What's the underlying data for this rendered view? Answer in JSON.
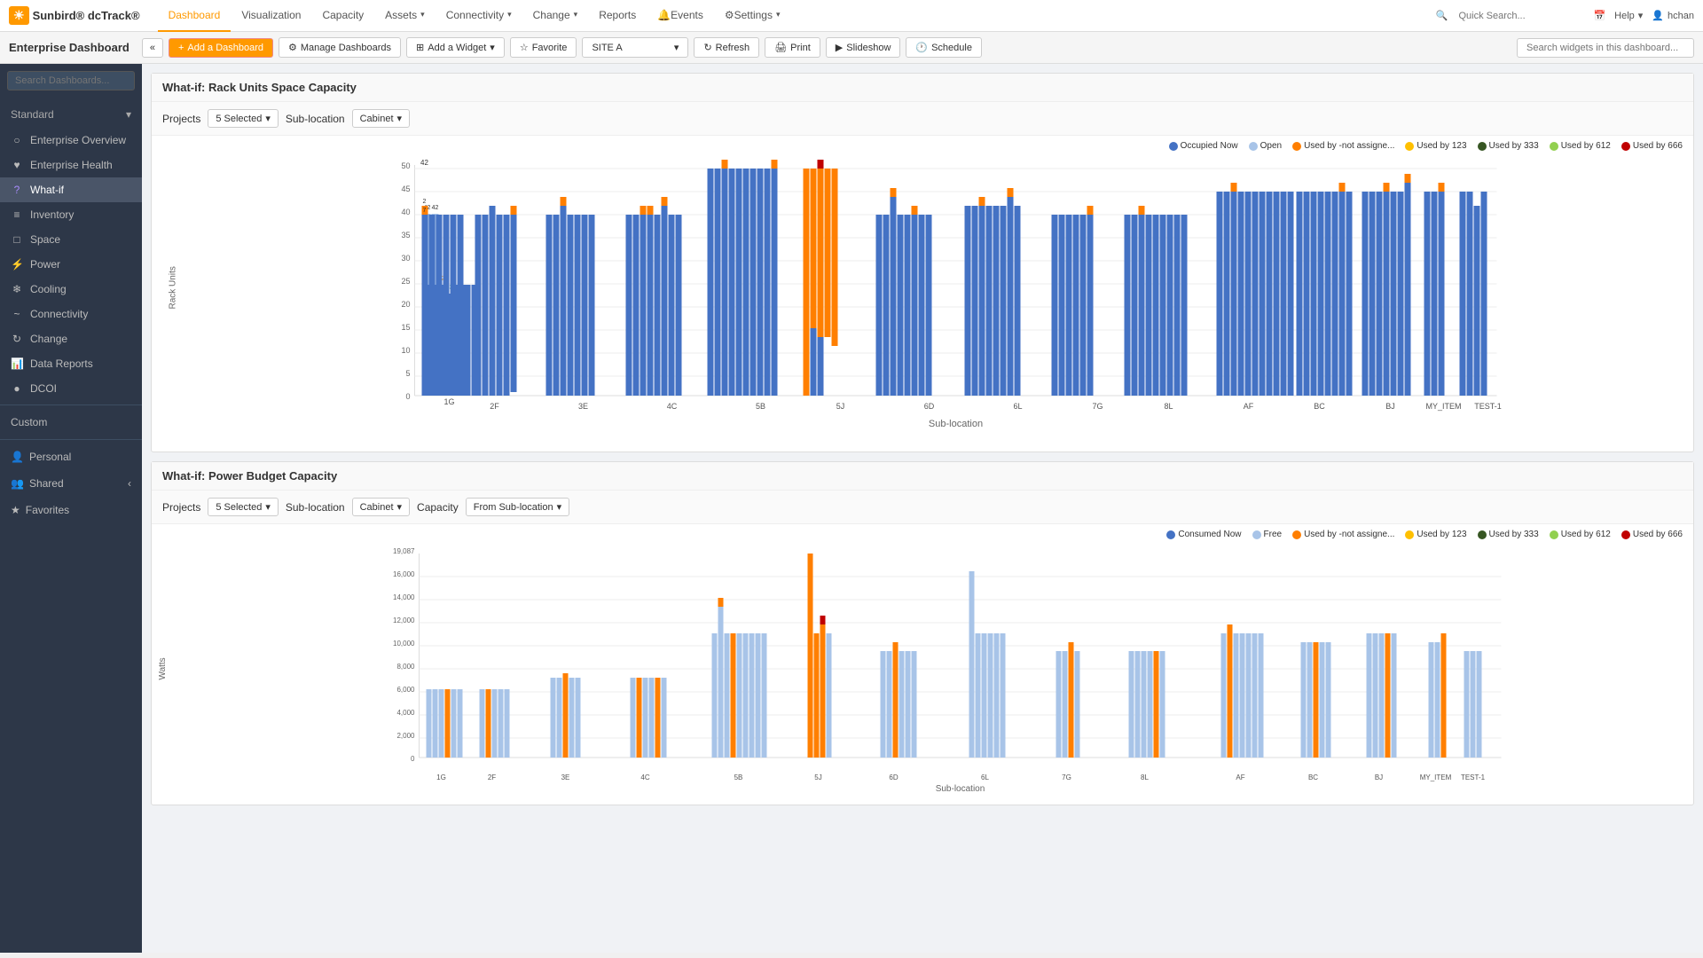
{
  "topnav": {
    "logo": "Sunbird® dcTrack®",
    "nav_items": [
      {
        "label": "Dashboard",
        "active": true,
        "has_caret": false
      },
      {
        "label": "Visualization",
        "active": false,
        "has_caret": false
      },
      {
        "label": "Capacity",
        "active": false,
        "has_caret": false
      },
      {
        "label": "Assets",
        "active": false,
        "has_caret": true
      },
      {
        "label": "Connectivity",
        "active": false,
        "has_caret": true
      },
      {
        "label": "Change",
        "active": false,
        "has_caret": true
      },
      {
        "label": "Reports",
        "active": false,
        "has_caret": false
      },
      {
        "label": "Events",
        "active": false,
        "has_caret": false,
        "bell": true
      },
      {
        "label": "Settings",
        "active": false,
        "has_caret": true,
        "gear": true
      }
    ],
    "quick_search_placeholder": "Quick Search...",
    "help_label": "Help",
    "user_label": "hchan"
  },
  "toolbar": {
    "title": "Enterprise Dashboard",
    "collapse_icon": "«",
    "add_dashboard_label": "Add a Dashboard",
    "manage_dashboards_label": "Manage Dashboards",
    "add_widget_label": "Add a Widget",
    "favorite_label": "Favorite",
    "site_value": "SITE A",
    "refresh_label": "Refresh",
    "print_label": "Print",
    "slideshow_label": "Slideshow",
    "schedule_label": "Schedule",
    "widget_search_placeholder": "Search widgets in this dashboard..."
  },
  "sidebar": {
    "search_placeholder": "Search Dashboards...",
    "standard_label": "Standard",
    "items": [
      {
        "label": "Enterprise Overview",
        "icon": "○"
      },
      {
        "label": "Enterprise Health",
        "icon": "♥"
      },
      {
        "label": "What-if",
        "icon": "?",
        "active": true
      },
      {
        "label": "Inventory",
        "icon": "≡"
      },
      {
        "label": "Space",
        "icon": "□"
      },
      {
        "label": "Power",
        "icon": "⚡"
      },
      {
        "label": "Cooling",
        "icon": "❄"
      },
      {
        "label": "Connectivity",
        "icon": "~"
      },
      {
        "label": "Change",
        "icon": "↻"
      },
      {
        "label": "Data Reports",
        "icon": "📊"
      },
      {
        "label": "DCOI",
        "icon": "●"
      }
    ],
    "custom_label": "Custom",
    "personal_label": "Personal",
    "shared_label": "Shared",
    "shared_arrow": "‹",
    "favorites_label": "Favorites"
  },
  "widget1": {
    "title": "What-if: Rack Units Space Capacity",
    "projects_label": "Projects",
    "projects_value": "5 Selected",
    "sublocation_label": "Sub-location",
    "sublocation_value": "Cabinet",
    "legend": [
      {
        "label": "Occupied Now",
        "color": "#4472C4"
      },
      {
        "label": "Open",
        "color": "#a8c4e8"
      },
      {
        "label": "Used by -not assigne...",
        "color": "#FF7F00"
      },
      {
        "label": "Used by 123",
        "color": "#FFC000"
      },
      {
        "label": "Used by 333",
        "color": "#375623"
      },
      {
        "label": "Used by 612",
        "color": "#92D050"
      },
      {
        "label": "Used by 666",
        "color": "#C00000"
      }
    ],
    "x_axis_label": "Sub-location",
    "y_axis_label": "Rack Units",
    "groups": [
      "1G",
      "2F",
      "3E",
      "4C",
      "5B",
      "5J",
      "6D",
      "6L",
      "7G",
      "8L",
      "AF",
      "BC",
      "BJ",
      "MY_ITEM",
      "TEST-1"
    ]
  },
  "widget2": {
    "title": "What-if: Power Budget Capacity",
    "projects_label": "Projects",
    "projects_value": "5 Selected",
    "sublocation_label": "Sub-location",
    "sublocation_value": "Cabinet",
    "capacity_label": "Capacity",
    "capacity_value": "From Sub-location",
    "legend": [
      {
        "label": "Consumed Now",
        "color": "#4472C4"
      },
      {
        "label": "Free",
        "color": "#a8c4e8"
      },
      {
        "label": "Used by -not assigne...",
        "color": "#FF7F00"
      },
      {
        "label": "Used by 123",
        "color": "#FFC000"
      },
      {
        "label": "Used by 333",
        "color": "#375623"
      },
      {
        "label": "Used by 612",
        "color": "#92D050"
      },
      {
        "label": "Used by 666",
        "color": "#C00000"
      }
    ],
    "x_axis_label": "Sub-location",
    "y_axis_label": "Watts",
    "max_value": "19,087"
  }
}
